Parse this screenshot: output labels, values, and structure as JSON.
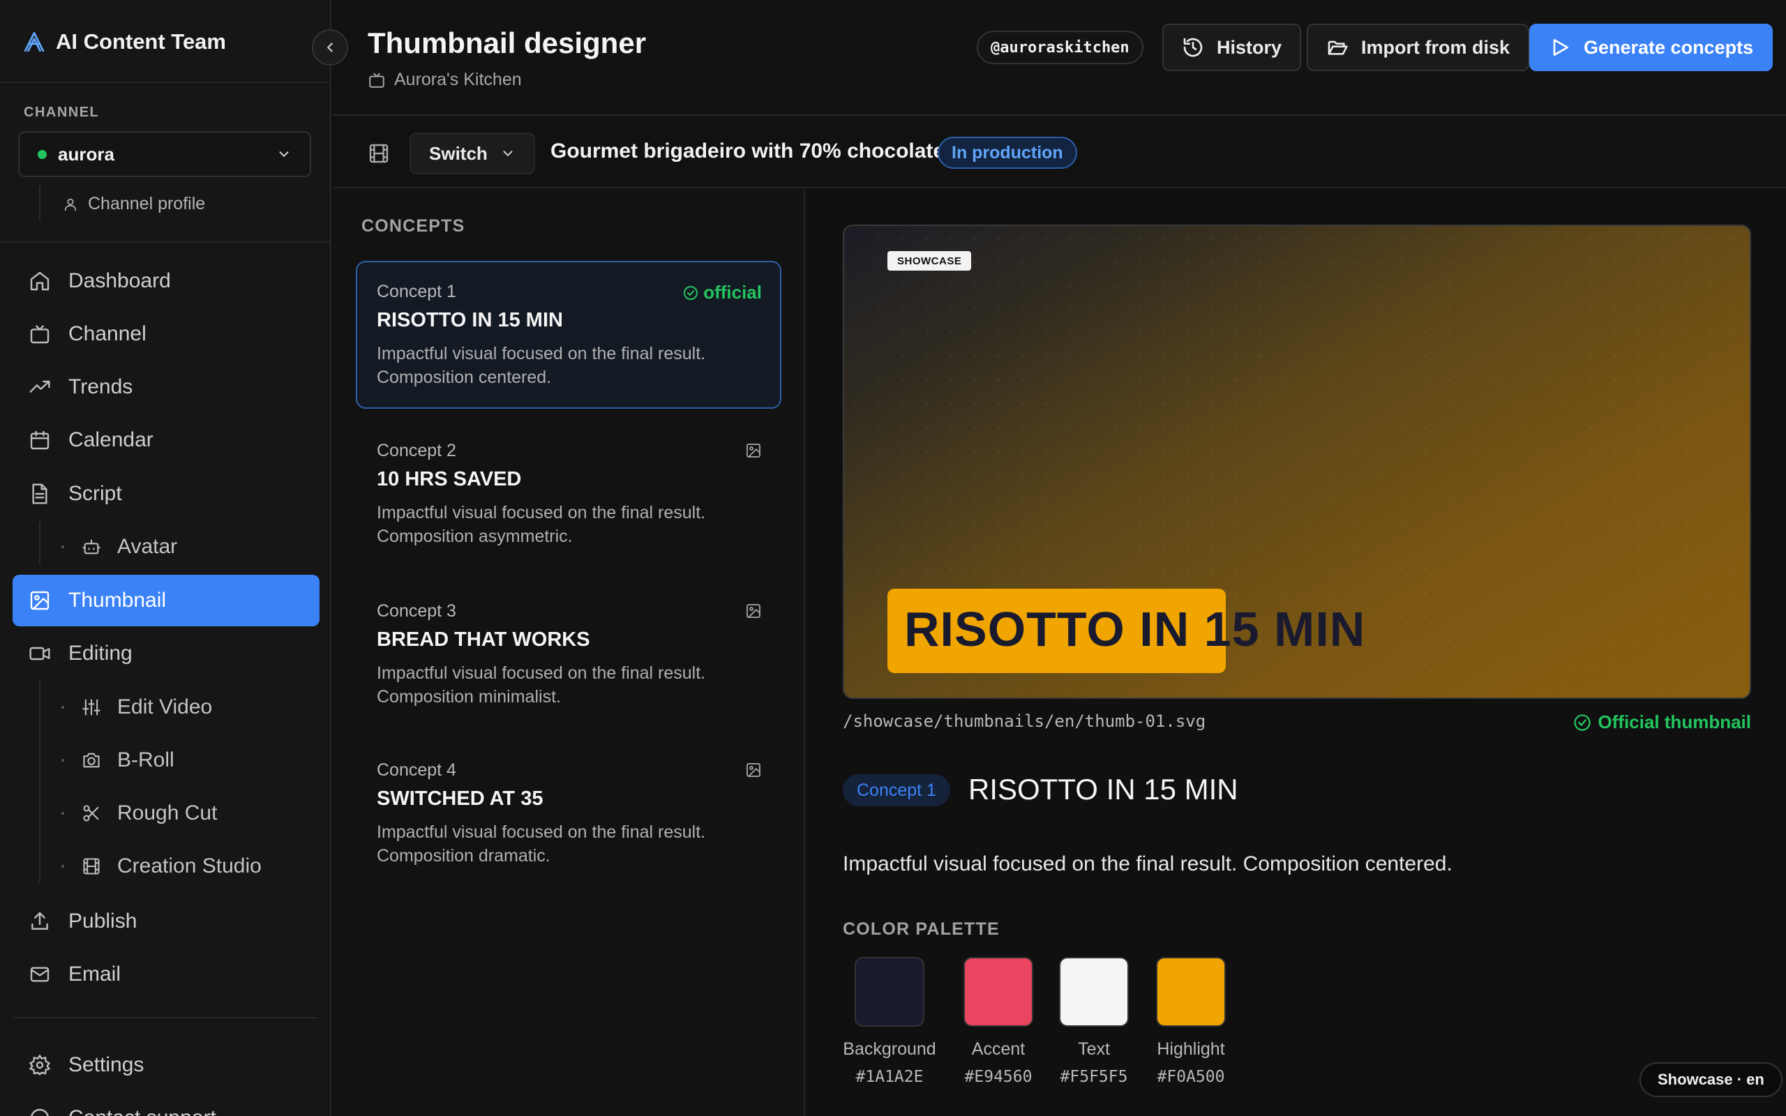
{
  "sidebar": {
    "brand": "AI Content Team",
    "channel_label": "CHANNEL",
    "channel_name": "aurora",
    "channel_profile": "Channel profile",
    "nav": {
      "dashboard": "Dashboard",
      "channel": "Channel",
      "trends": "Trends",
      "calendar": "Calendar",
      "script": "Script",
      "avatar": "Avatar",
      "thumbnail": "Thumbnail",
      "editing": "Editing",
      "edit_video": "Edit Video",
      "b_roll": "B-Roll",
      "rough_cut": "Rough Cut",
      "creation_studio": "Creation Studio",
      "publish": "Publish",
      "email": "Email",
      "settings": "Settings",
      "contact_support": "Contact support"
    },
    "active_item": "Thumbnail"
  },
  "header": {
    "title": "Thumbnail designer",
    "subtitle": "Aurora's Kitchen",
    "handle": "@auroraskitchen",
    "history_label": "History",
    "import_label": "Import from disk",
    "generate_label": "Generate concepts"
  },
  "subheader": {
    "switch_label": "Switch",
    "video_title": "Gourmet brigadeiro with 70% chocolate",
    "status": "In production"
  },
  "concepts": {
    "label": "CONCEPTS",
    "items": [
      {
        "number": "Concept 1",
        "title": "RISOTTO IN 15 MIN",
        "description": "Impactful visual focused on the final result. Composition centered.",
        "official": true,
        "official_label": "official"
      },
      {
        "number": "Concept 2",
        "title": "10 HRS SAVED",
        "description": "Impactful visual focused on the final result. Composition asymmetric.",
        "official": false
      },
      {
        "number": "Concept 3",
        "title": "BREAD THAT WORKS",
        "description": "Impactful visual focused on the final result. Composition minimalist.",
        "official": false
      },
      {
        "number": "Concept 4",
        "title": "SWITCHED AT 35",
        "description": "Impactful visual focused on the final result. Composition dramatic.",
        "official": false
      }
    ]
  },
  "detail": {
    "showcase_tag": "SHOWCASE",
    "thumb_text": "RISOTTO IN 15 MIN",
    "file_path": "/showcase/thumbnails/en/thumb-01.svg",
    "official_label": "Official thumbnail",
    "concept_pill": "Concept 1",
    "title": "RISOTTO IN 15 MIN",
    "description": "Impactful visual focused on the final result. Composition centered.",
    "palette_label": "COLOR PALETTE",
    "palette": [
      {
        "name": "Background",
        "hex": "#1A1A2E"
      },
      {
        "name": "Accent",
        "hex": "#E94560"
      },
      {
        "name": "Text",
        "hex": "#F5F5F5"
      },
      {
        "name": "Highlight",
        "hex": "#F0A500"
      }
    ]
  },
  "footer_badge": "Showcase · en",
  "colors": {
    "accent": "#3b82f6",
    "success": "#22c55e",
    "background": "#101010"
  }
}
